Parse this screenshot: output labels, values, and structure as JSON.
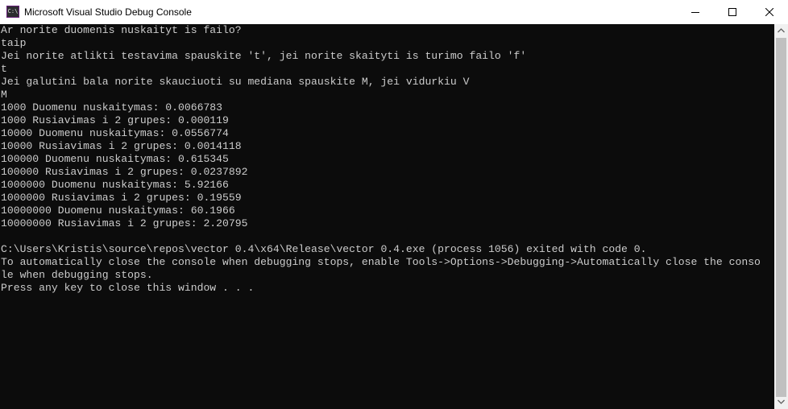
{
  "window": {
    "title": "Microsoft Visual Studio Debug Console",
    "icon": "console-app-icon",
    "icon_label": "C:\\"
  },
  "controls": {
    "minimize": "minimize-icon",
    "maximize": "maximize-icon",
    "close": "close-icon"
  },
  "console": {
    "lines": [
      "Ar norite duomenis nuskaityt is failo?",
      "taip",
      "Jei norite atlikti testavima spauskite 't', jei norite skaityti is turimo failo 'f'",
      "t",
      "Jei galutini bala norite skauciuoti su mediana spauskite M, jei vidurkiu V",
      "M",
      "1000 Duomenu nuskaitymas: 0.0066783",
      "1000 Rusiavimas i 2 grupes: 0.000119",
      "10000 Duomenu nuskaitymas: 0.0556774",
      "10000 Rusiavimas i 2 grupes: 0.0014118",
      "100000 Duomenu nuskaitymas: 0.615345",
      "100000 Rusiavimas i 2 grupes: 0.0237892",
      "1000000 Duomenu nuskaitymas: 5.92166",
      "1000000 Rusiavimas i 2 grupes: 0.19559",
      "10000000 Duomenu nuskaitymas: 60.1966",
      "10000000 Rusiavimas i 2 grupes: 2.20795",
      "",
      "C:\\Users\\Kristis\\source\\repos\\vector 0.4\\x64\\Release\\vector 0.4.exe (process 1056) exited with code 0.",
      "To automatically close the console when debugging stops, enable Tools->Options->Debugging->Automatically close the conso",
      "le when debugging stops.",
      "Press any key to close this window . . ."
    ]
  },
  "colors": {
    "console_background": "#0c0c0c",
    "console_text": "#cccccc",
    "titlebar": "#ffffff"
  }
}
